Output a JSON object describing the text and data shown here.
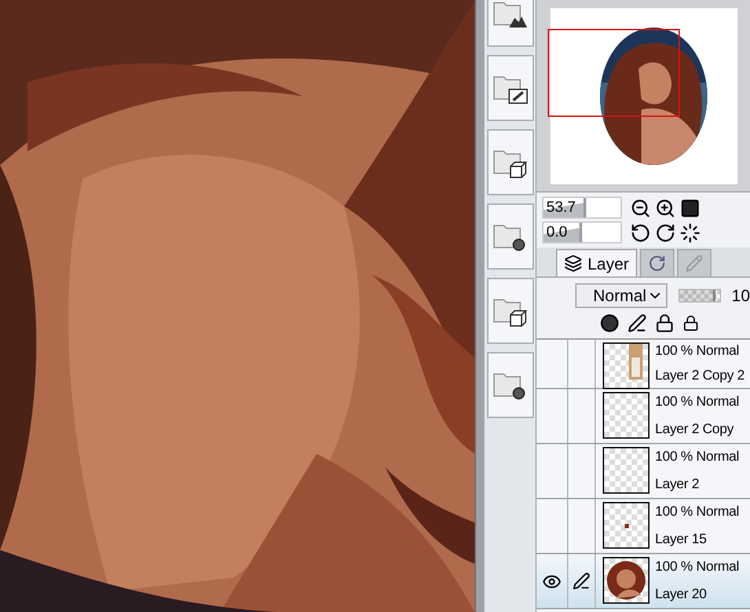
{
  "navigator": {
    "zoom": {
      "reading": "53.7",
      "level": 0.55
    },
    "angle": {
      "reading": "0.0",
      "level": 0.5
    }
  },
  "tabs": [
    {
      "label": "Layer",
      "selected": true
    },
    {
      "selected": false
    },
    {
      "selected": false
    }
  ],
  "blend_mode": "Normal",
  "opacity": {
    "reading": "10",
    "level": 0.9
  },
  "layers": [
    {
      "mode": "100 % Normal",
      "name": "Layer 2 Copy 2",
      "kind": "picture",
      "visible": false,
      "selected": false
    },
    {
      "mode": "100 % Normal",
      "name": "Layer 2 Copy",
      "kind": "empty",
      "visible": false,
      "selected": false
    },
    {
      "mode": "100 % Normal",
      "name": "Layer 2",
      "kind": "empty",
      "visible": false,
      "selected": false
    },
    {
      "mode": "100 % Normal",
      "name": "Layer 15",
      "kind": "dot",
      "visible": false,
      "selected": false
    },
    {
      "mode": "100 % Normal",
      "name": "Layer 20",
      "kind": "portrait",
      "visible": true,
      "selected": true
    }
  ]
}
